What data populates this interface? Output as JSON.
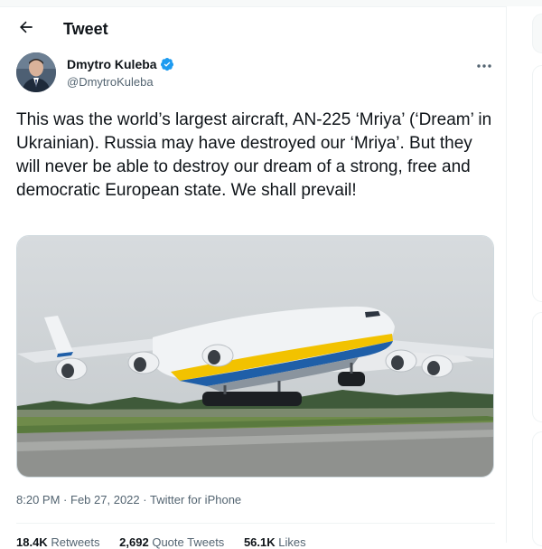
{
  "header": {
    "title": "Tweet",
    "back_icon": "arrow-left-icon"
  },
  "author": {
    "name": "Dmytro Kuleba",
    "handle": "@DmytroKuleba",
    "verified": true,
    "verified_color": "#1d9bf0"
  },
  "tweet": {
    "text": "This was the world’s largest aircraft, AN-225 ‘Mriya’ (‘Dream’ in Ukrainian). Russia may have destroyed our ‘Mriya’. But they will never be able to destroy our dream of a strong, free and democratic European state. We shall prevail!",
    "media": {
      "kind": "photo",
      "subject": "AN-225 Mriya aircraft taking off",
      "livery_colors": [
        "#f2c200",
        "#1f5fa8"
      ]
    },
    "time": "8:20 PM",
    "separator": "·",
    "date": "Feb 27, 2022",
    "source": "Twitter for iPhone"
  },
  "stats": {
    "retweets_count": "18.4K",
    "retweets_label": "Retweets",
    "quotes_count": "2,692",
    "quotes_label": "Quote Tweets",
    "likes_count": "56.1K",
    "likes_label": "Likes"
  },
  "accent_color": "#1d9bf0"
}
